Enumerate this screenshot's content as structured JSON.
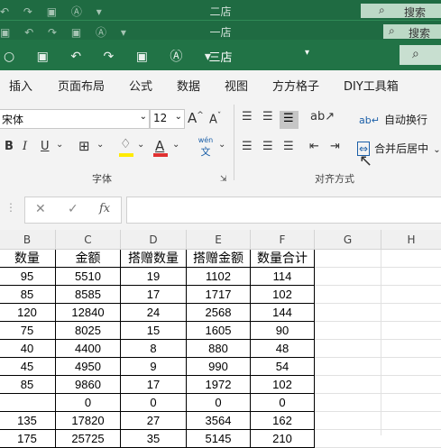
{
  "windows": [
    {
      "title": "二店",
      "search": "搜索"
    },
    {
      "title": "一店",
      "search": "搜索"
    },
    {
      "title": "三店",
      "search": ""
    }
  ],
  "menu": [
    "插入",
    "页面布局",
    "公式",
    "数据",
    "视图",
    "方方格子",
    "DIY工具箱"
  ],
  "ribbon": {
    "font_name": "宋体",
    "font_size": "12",
    "font_grow": "A",
    "font_shrink": "A",
    "bold": "B",
    "italic": "I",
    "underline": "U",
    "font_color_label": "A",
    "wen_label": "wén",
    "wen_char": "文",
    "font_group_label": "字体",
    "wrap_text": "自动换行",
    "merge_center": "合并后居中",
    "align_group_label": "对齐方式"
  },
  "formula_bar": {
    "fx": "fx",
    "value": ""
  },
  "colors": {
    "excel_green": "#217346",
    "highlight_yellow": "#ffeb00",
    "font_red": "#e03030"
  },
  "grid": {
    "columns": [
      "B",
      "C",
      "D",
      "E",
      "F",
      "G",
      "H"
    ],
    "headers": [
      "数量",
      "金额",
      "搭赠数量",
      "搭赠金额",
      "数量合计"
    ],
    "rows": [
      [
        "95",
        "5510",
        "19",
        "1102",
        "114"
      ],
      [
        "85",
        "8585",
        "17",
        "1717",
        "102"
      ],
      [
        "120",
        "12840",
        "24",
        "2568",
        "144"
      ],
      [
        "75",
        "8025",
        "15",
        "1605",
        "90"
      ],
      [
        "40",
        "4400",
        "8",
        "880",
        "48"
      ],
      [
        "45",
        "4950",
        "9",
        "990",
        "54"
      ],
      [
        "85",
        "9860",
        "17",
        "1972",
        "102"
      ],
      [
        "",
        "0",
        "0",
        "0",
        "0"
      ],
      [
        "135",
        "17820",
        "27",
        "3564",
        "162"
      ],
      [
        "175",
        "25725",
        "35",
        "5145",
        "210"
      ]
    ]
  }
}
